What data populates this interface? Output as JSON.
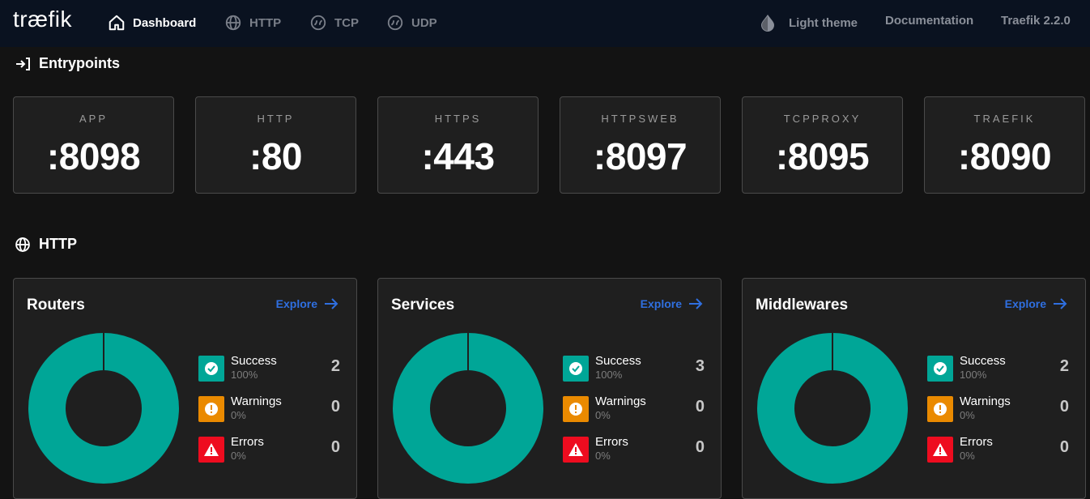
{
  "app": {
    "logo": "træfik"
  },
  "nav": {
    "items": [
      {
        "label": "Dashboard",
        "icon": "home-icon",
        "active": true
      },
      {
        "label": "HTTP",
        "icon": "globe-icon",
        "active": false
      },
      {
        "label": "TCP",
        "icon": "tcp-icon",
        "active": false
      },
      {
        "label": "UDP",
        "icon": "udp-icon",
        "active": false
      }
    ],
    "theme_label": "Light theme",
    "docs_label": "Documentation",
    "version_label": "Traefik 2.2.0"
  },
  "entrypoints": {
    "title": "Entrypoints",
    "items": [
      {
        "name": "APP",
        "port": ":8098"
      },
      {
        "name": "HTTP",
        "port": ":80"
      },
      {
        "name": "HTTPS",
        "port": ":443"
      },
      {
        "name": "HTTPSWEB",
        "port": ":8097"
      },
      {
        "name": "TCPPROXY",
        "port": ":8095"
      },
      {
        "name": "TRAEFIK",
        "port": ":8090"
      }
    ]
  },
  "http": {
    "title": "HTTP",
    "cards": [
      {
        "title": "Routers",
        "explore": "Explore",
        "success": {
          "label": "Success",
          "pct": "100%",
          "count": "2"
        },
        "warnings": {
          "label": "Warnings",
          "pct": "0%",
          "count": "0"
        },
        "errors": {
          "label": "Errors",
          "pct": "0%",
          "count": "0"
        }
      },
      {
        "title": "Services",
        "explore": "Explore",
        "success": {
          "label": "Success",
          "pct": "100%",
          "count": "3"
        },
        "warnings": {
          "label": "Warnings",
          "pct": "0%",
          "count": "0"
        },
        "errors": {
          "label": "Errors",
          "pct": "0%",
          "count": "0"
        }
      },
      {
        "title": "Middlewares",
        "explore": "Explore",
        "success": {
          "label": "Success",
          "pct": "100%",
          "count": "2"
        },
        "warnings": {
          "label": "Warnings",
          "pct": "0%",
          "count": "0"
        },
        "errors": {
          "label": "Errors",
          "pct": "0%",
          "count": "0"
        }
      }
    ]
  },
  "colors": {
    "success": "#00a697",
    "warning": "#ea8a00",
    "error": "#ee0c1f",
    "accent": "#2f6fe0",
    "nav_bg": "#0a1220"
  }
}
